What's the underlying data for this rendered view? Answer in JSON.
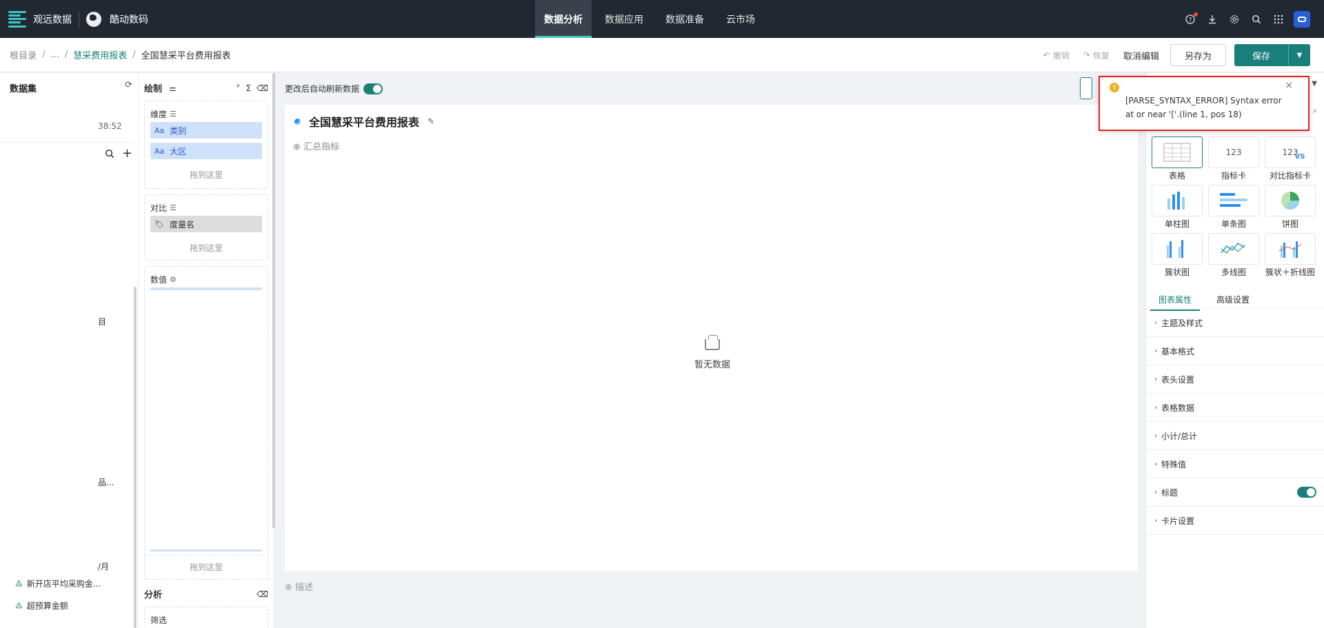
{
  "topbar": {
    "logo_text": "观远数据",
    "org_name": "酷动数码",
    "nav": [
      "数据分析",
      "数据应用",
      "数据准备",
      "云市场"
    ],
    "active_nav": "数据分析"
  },
  "breadcrumb": {
    "items": [
      "根目录",
      "...",
      "慧采费用报表",
      "全国慧采平台费用报表"
    ],
    "undo": "撤销",
    "redo": "恢复",
    "cancel_edit": "取消编辑",
    "save_as": "另存为",
    "save": "保存"
  },
  "dataset_panel": {
    "title": "数据集",
    "partial_time": "38:52",
    "partial_1": "目",
    "partial_2": "品...",
    "partial_3": "/月",
    "field_partial": "新开店平均采购金...",
    "field_over_budget": "超预算金额"
  },
  "draw_panel": {
    "title": "绘制",
    "dimension_label": "维度",
    "dimension_fields": [
      "类别",
      "大区"
    ],
    "field_type": "Aa",
    "contrast_label": "对比",
    "contrast_fields": [
      "度量名"
    ],
    "value_label": "数值",
    "drop_hint": "拖到这里",
    "analysis_label": "分析",
    "filter_label": "筛选"
  },
  "canvas": {
    "auto_refresh_label": "更改后自动刷新数据",
    "auto_refresh_on": true,
    "card_title": "全国慧采平台费用报表",
    "summary_metric": "汇总指标",
    "empty_text": "暂无数据",
    "describe": "描述"
  },
  "chart_panel": {
    "chart_types": [
      {
        "name": "表格",
        "icon": "table-icon"
      },
      {
        "name": "指标卡",
        "icon": "kpi-card-icon"
      },
      {
        "name": "对比指标卡",
        "icon": "compare-kpi-icon"
      },
      {
        "name": "单柱图",
        "icon": "column-chart-icon"
      },
      {
        "name": "单条图",
        "icon": "bar-chart-icon"
      },
      {
        "name": "饼图",
        "icon": "pie-chart-icon"
      },
      {
        "name": "簇状图",
        "icon": "cluster-chart-icon"
      },
      {
        "name": "多线图",
        "icon": "multi-line-chart-icon"
      },
      {
        "name": "簇状＋折线图",
        "icon": "cluster-line-chart-icon"
      }
    ],
    "kpi_text": "123",
    "vs_text": "VS",
    "tabs": [
      "图表属性",
      "高级设置"
    ],
    "properties": [
      "主题及样式",
      "基本格式",
      "表头设置",
      "表格数据",
      "小计/总计",
      "特殊值",
      "标题",
      "卡片设置"
    ],
    "title_toggle_on": true
  },
  "toast": {
    "message": "[PARSE_SYNTAX_ERROR] Syntax error at or near '['.(line 1, pos 18)",
    "warn_glyph": "!"
  },
  "colors": {
    "accent": "#1a7f7a",
    "topbar_bg": "#222831",
    "field_bg": "#cfe0fb",
    "error_border": "#e02020"
  }
}
